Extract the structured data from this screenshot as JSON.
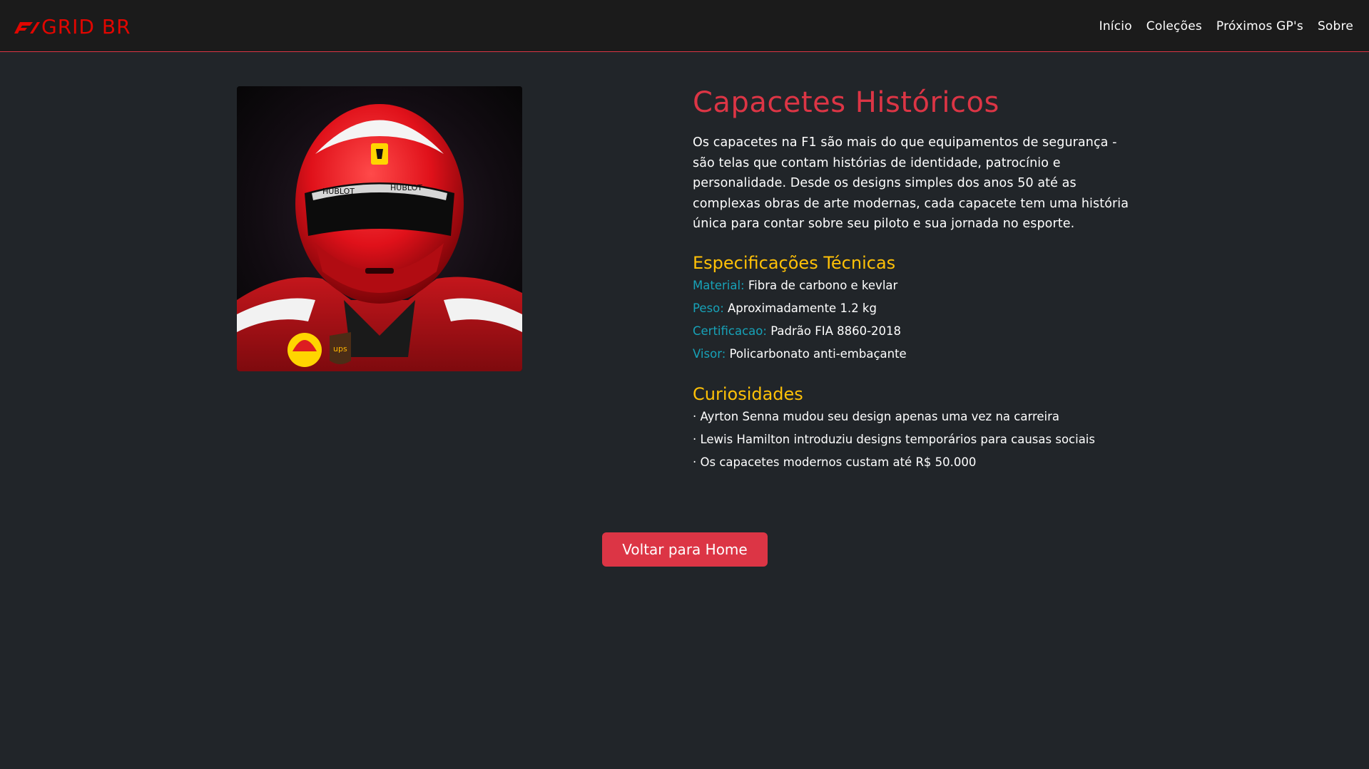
{
  "brand": {
    "name": "GRID BR",
    "color": "#e10600",
    "logo_icon": "f1-logo-icon"
  },
  "nav": {
    "items": [
      {
        "label": "Início"
      },
      {
        "label": "Coleções"
      },
      {
        "label": "Próximos GP's"
      },
      {
        "label": "Sobre"
      }
    ]
  },
  "main": {
    "image_icon": "helmet-photo",
    "title": "Capacetes Históricos",
    "description": "Os capacetes na F1 são mais do que equipamentos de segurança - são telas que contam histórias de identidade, patrocínio e personalidade. Desde os designs simples dos anos 50 até as complexas obras de arte modernas, cada capacete tem uma história única para contar sobre seu piloto e sua jornada no esporte.",
    "specs_title": "Especificações Técnicas",
    "specs": [
      {
        "label": "Material:",
        "value": "Fibra de carbono e kevlar"
      },
      {
        "label": "Peso:",
        "value": "Aproximadamente 1.2 kg"
      },
      {
        "label": "Certificacao:",
        "value": "Padrão FIA 8860-2018"
      },
      {
        "label": "Visor:",
        "value": "Policarbonato anti-embaçante"
      }
    ],
    "curiosities_title": "Curiosidades",
    "curiosities": [
      "· Ayrton Senna mudou seu design apenas uma vez na carreira",
      "· Lewis Hamilton introduziu designs temporários para causas sociais",
      "· Os capacetes modernos custam até R$ 50.000"
    ],
    "back_button": "Voltar para Home"
  },
  "colors": {
    "background": "#212529",
    "navbar": "#1b1b1b",
    "accent_red": "#dc3545",
    "heading_yellow": "#ffc107",
    "label_cyan": "#17a2b8"
  }
}
